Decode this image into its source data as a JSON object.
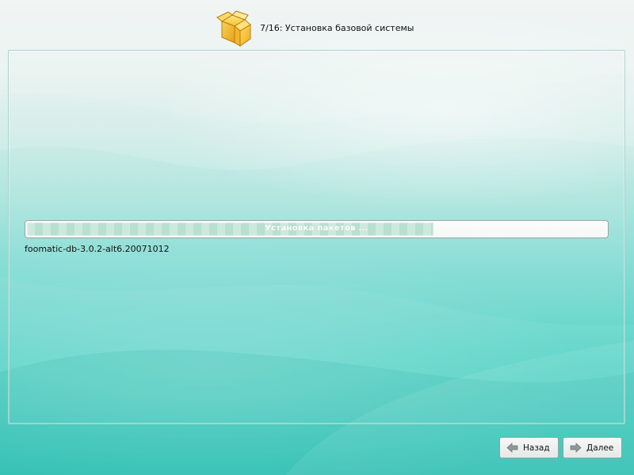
{
  "header": {
    "title": "7/16: Установка базовой системы",
    "icon": "package-box-icon"
  },
  "progress": {
    "label": "Установка пакетов ...",
    "value_percent": 70
  },
  "status": {
    "package_name": "foomatic-db-3.0.2-alt6.20071012"
  },
  "buttons": {
    "back": {
      "label": "Назад",
      "icon": "back-arrow-icon"
    },
    "next": {
      "label": "Далее",
      "icon": "next-arrow-icon"
    }
  },
  "colors": {
    "accent": "#31c5b7",
    "panel_border": "#aad3cc",
    "progress_fill": "#c3e6d6",
    "text": "#111111"
  }
}
